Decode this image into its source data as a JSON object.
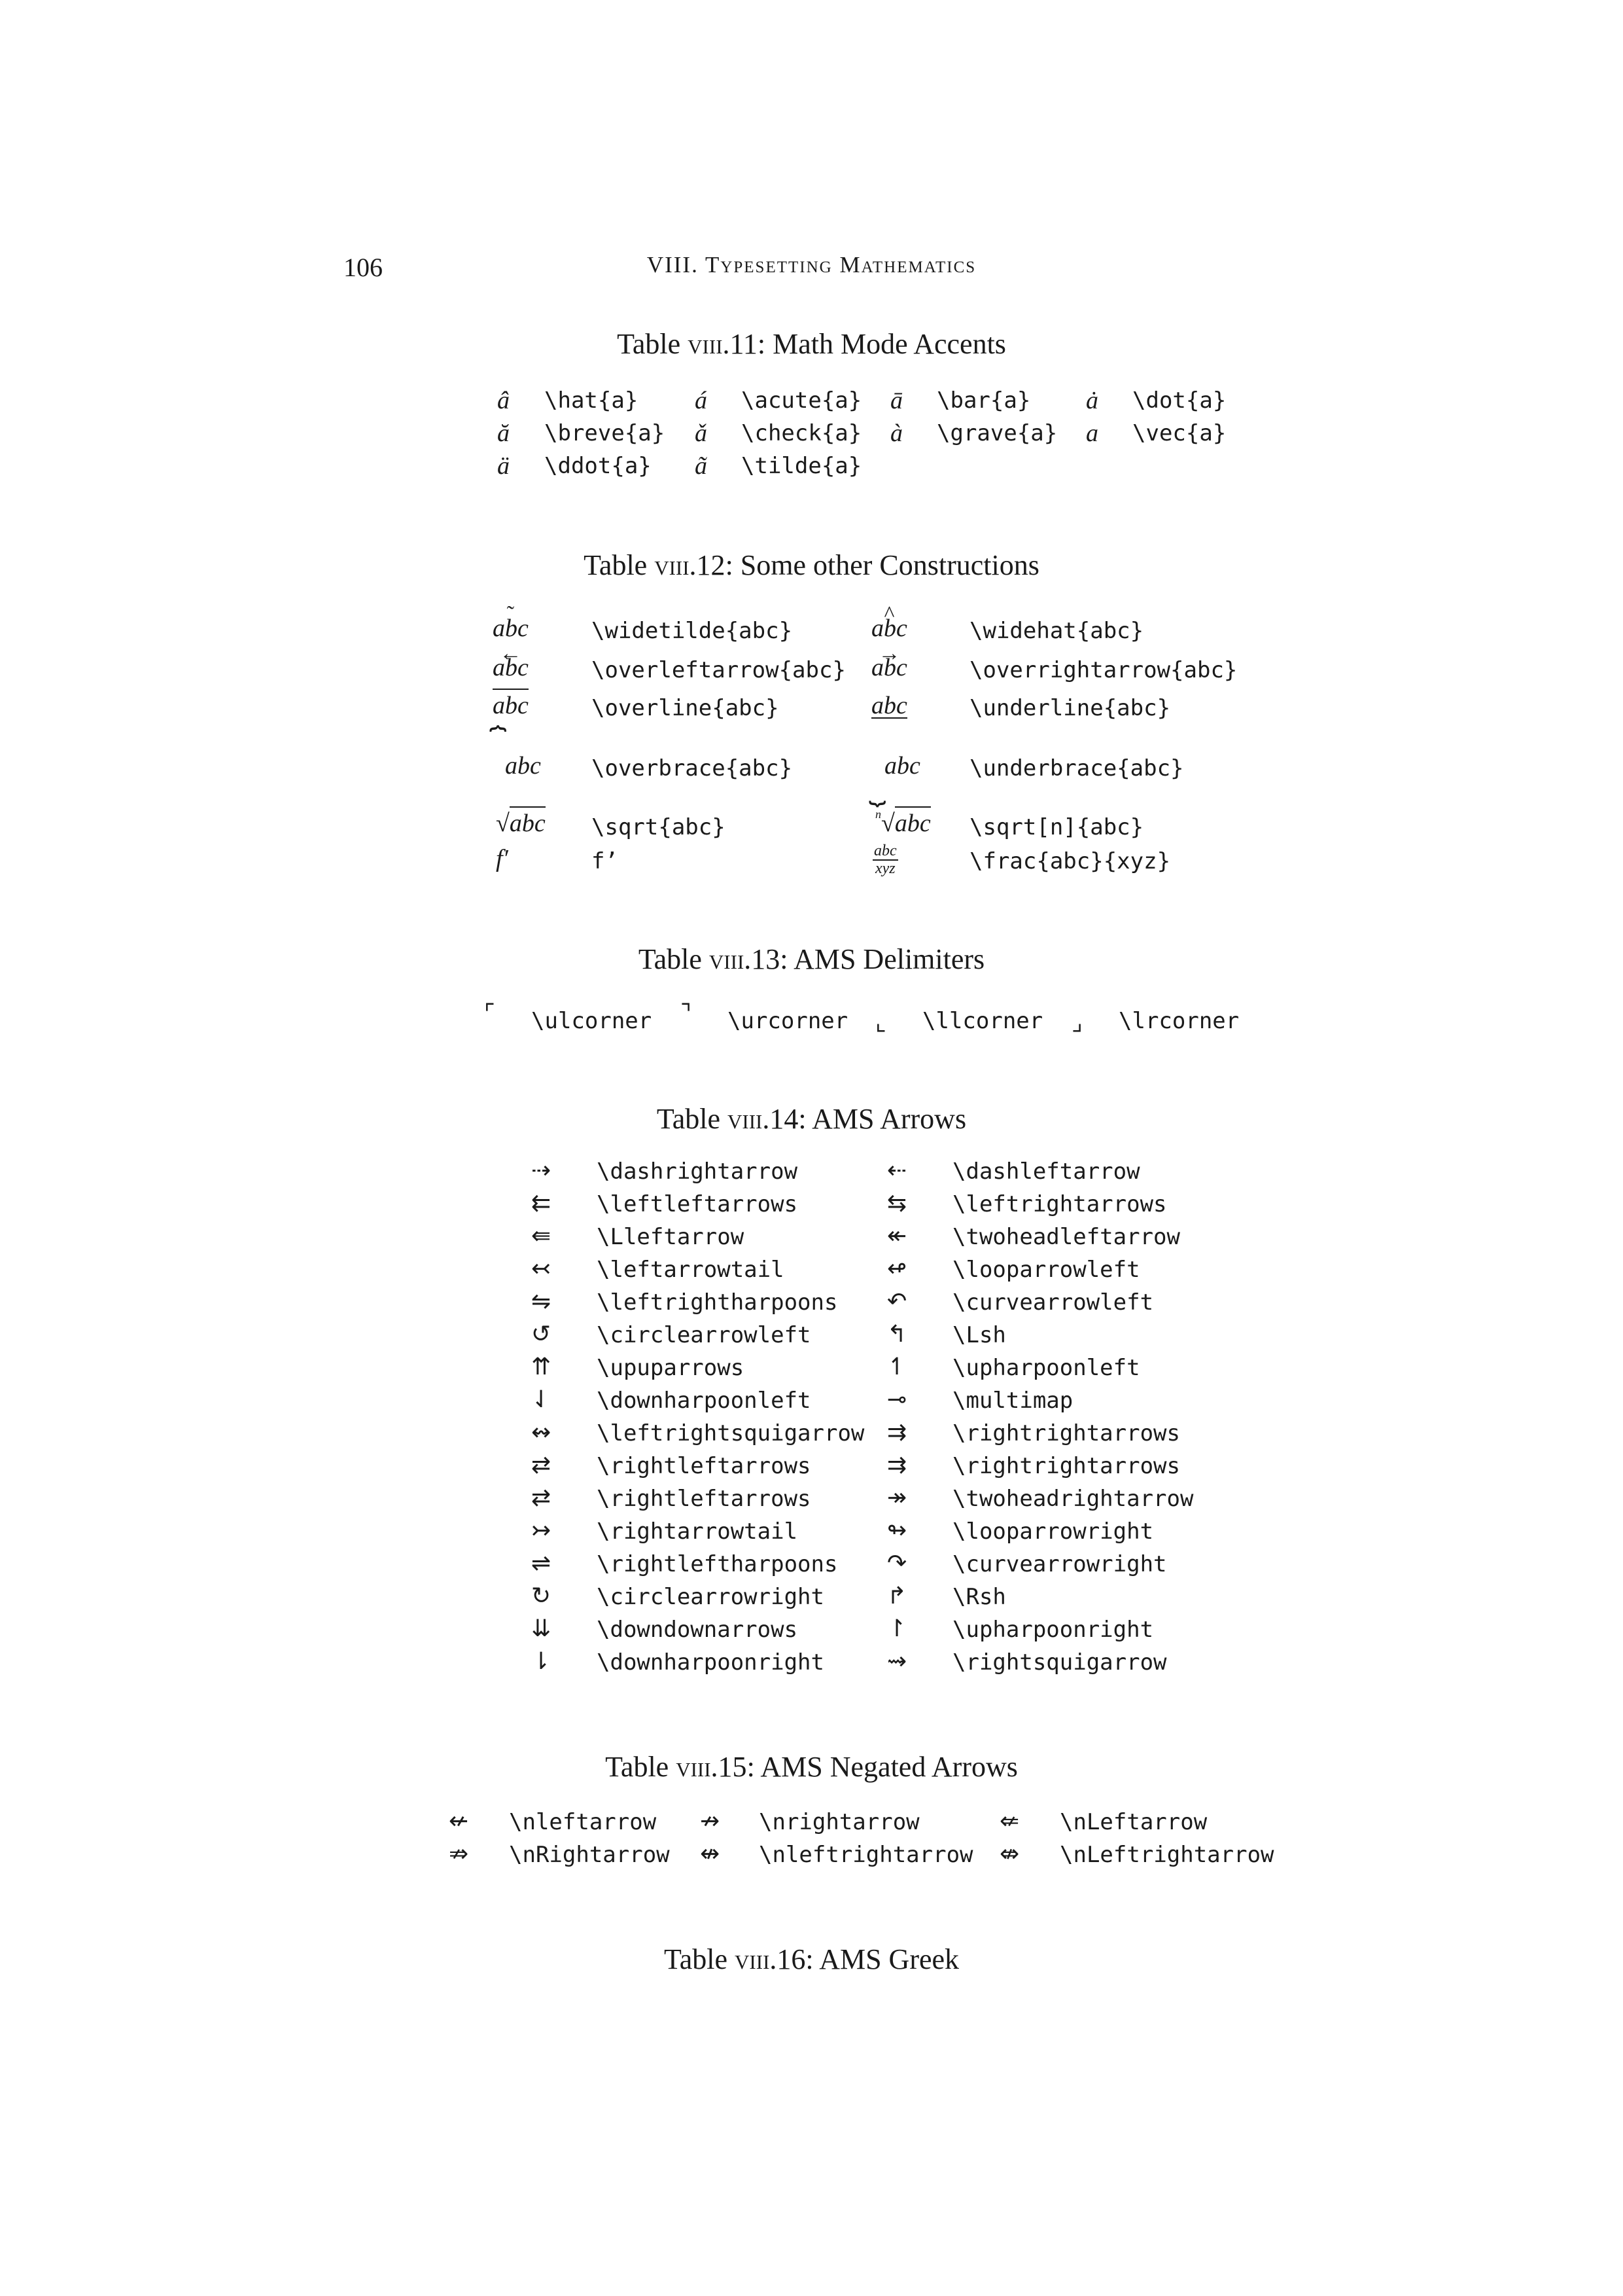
{
  "page": {
    "number": "106",
    "running_head": "VIII. Typesetting Mathematics"
  },
  "tables": {
    "t11": {
      "caption_prefix": "Table ",
      "caption_num": "viii.11",
      "caption_text": ": Math Mode Accents",
      "rows": [
        [
          {
            "sym": "â",
            "cmd": "\\hat{a}"
          },
          {
            "sym": "á",
            "cmd": "\\acute{a}"
          },
          {
            "sym": "ā",
            "cmd": "\\bar{a}"
          },
          {
            "sym": "ȧ",
            "cmd": "\\dot{a}"
          }
        ],
        [
          {
            "sym": "ă",
            "cmd": "\\breve{a}"
          },
          {
            "sym": "ǎ",
            "cmd": "\\check{a}"
          },
          {
            "sym": "à",
            "cmd": "\\grave{a}"
          },
          {
            "sym": "a⃗",
            "cmd": "\\vec{a}"
          }
        ],
        [
          {
            "sym": "ä",
            "cmd": "\\ddot{a}"
          },
          {
            "sym": "ã",
            "cmd": "\\tilde{a}"
          }
        ]
      ]
    },
    "t12": {
      "caption_prefix": "Table ",
      "caption_num": "viii.12",
      "caption_text": ": Some other Constructions",
      "base": "abc",
      "tilde_mark": "˜",
      "hat_mark": "^",
      "left_arrow_mark": "←",
      "right_arrow_mark": "→",
      "overbrace_mark": "⏞",
      "underbrace_mark": "⏟",
      "sqrt_mark": "√",
      "root_index": "n",
      "fprime": "f′",
      "frac_num": "abc",
      "frac_den": "xyz",
      "cmds": {
        "widetilde": "\\widetilde{abc}",
        "widehat": "\\widehat{abc}",
        "overleftarrow": "\\overleftarrow{abc}",
        "overrightarrow": "\\overrightarrow{abc}",
        "overline": "\\overline{abc}",
        "underline": "\\underline{abc}",
        "overbrace": "\\overbrace{abc}",
        "underbrace": "\\underbrace{abc}",
        "sqrt": "\\sqrt{abc}",
        "sqrtn": "\\sqrt[n]{abc}",
        "fprime": "f’",
        "frac": "\\frac{abc}{xyz}"
      }
    },
    "t13": {
      "caption_prefix": "Table ",
      "caption_num": "viii.13",
      "caption_text": ": AMS Delimiters",
      "items": [
        {
          "sym": "⌜",
          "cmd": "\\ulcorner"
        },
        {
          "sym": "⌝",
          "cmd": "\\urcorner"
        },
        {
          "sym": "⌞",
          "cmd": "\\llcorner"
        },
        {
          "sym": "⌟",
          "cmd": "\\lrcorner"
        }
      ]
    },
    "t14": {
      "caption_prefix": "Table ",
      "caption_num": "viii.14",
      "caption_text": ": AMS Arrows",
      "rows": [
        [
          {
            "sym": "⇢",
            "cmd": "\\dashrightarrow"
          },
          {
            "sym": "⇠",
            "cmd": "\\dashleftarrow"
          }
        ],
        [
          {
            "sym": "⇇",
            "cmd": "\\leftleftarrows"
          },
          {
            "sym": "⇆",
            "cmd": "\\leftrightarrows"
          }
        ],
        [
          {
            "sym": "⇚",
            "cmd": "\\Lleftarrow"
          },
          {
            "sym": "↞",
            "cmd": "\\twoheadleftarrow"
          }
        ],
        [
          {
            "sym": "↢",
            "cmd": "\\leftarrowtail"
          },
          {
            "sym": "↫",
            "cmd": "\\looparrowleft"
          }
        ],
        [
          {
            "sym": "⇋",
            "cmd": "\\leftrightharpoons"
          },
          {
            "sym": "↶",
            "cmd": "\\curvearrowleft"
          }
        ],
        [
          {
            "sym": "↺",
            "cmd": "\\circlearrowleft"
          },
          {
            "sym": "↰",
            "cmd": "\\Lsh"
          }
        ],
        [
          {
            "sym": "⇈",
            "cmd": "\\upuparrows"
          },
          {
            "sym": "↿",
            "cmd": "\\upharpoonleft"
          }
        ],
        [
          {
            "sym": "⇃",
            "cmd": "\\downharpoonleft"
          },
          {
            "sym": "⊸",
            "cmd": "\\multimap"
          }
        ],
        [
          {
            "sym": "↭",
            "cmd": "\\leftrightsquigarrow"
          },
          {
            "sym": "⇉",
            "cmd": "\\rightrightarrows"
          }
        ],
        [
          {
            "sym": "⇄",
            "cmd": "\\rightleftarrows"
          },
          {
            "sym": "⇉",
            "cmd": "\\rightrightarrows"
          }
        ],
        [
          {
            "sym": "⇄",
            "cmd": "\\rightleftarrows"
          },
          {
            "sym": "↠",
            "cmd": "\\twoheadrightarrow"
          }
        ],
        [
          {
            "sym": "↣",
            "cmd": "\\rightarrowtail"
          },
          {
            "sym": "↬",
            "cmd": "\\looparrowright"
          }
        ],
        [
          {
            "sym": "⇌",
            "cmd": "\\rightleftharpoons"
          },
          {
            "sym": "↷",
            "cmd": "\\curvearrowright"
          }
        ],
        [
          {
            "sym": "↻",
            "cmd": "\\circlearrowright"
          },
          {
            "sym": "↱",
            "cmd": "\\Rsh"
          }
        ],
        [
          {
            "sym": "⇊",
            "cmd": "\\downdownarrows"
          },
          {
            "sym": "↾",
            "cmd": "\\upharpoonright"
          }
        ],
        [
          {
            "sym": "⇂",
            "cmd": "\\downharpoonright"
          },
          {
            "sym": "⇝",
            "cmd": "\\rightsquigarrow"
          }
        ]
      ]
    },
    "t15": {
      "caption_prefix": "Table ",
      "caption_num": "viii.15",
      "caption_text": ": AMS Negated Arrows",
      "rows": [
        [
          {
            "sym": "↚",
            "cmd": "\\nleftarrow"
          },
          {
            "sym": "↛",
            "cmd": "\\nrightarrow"
          },
          {
            "sym": "⇍",
            "cmd": "\\nLeftarrow"
          }
        ],
        [
          {
            "sym": "⇏",
            "cmd": "\\nRightarrow"
          },
          {
            "sym": "↮",
            "cmd": "\\nleftrightarrow"
          },
          {
            "sym": "⇎",
            "cmd": "\\nLeftrightarrow"
          }
        ]
      ]
    },
    "t16": {
      "caption_prefix": "Table ",
      "caption_num": "viii.16",
      "caption_text": ": AMS Greek"
    }
  }
}
